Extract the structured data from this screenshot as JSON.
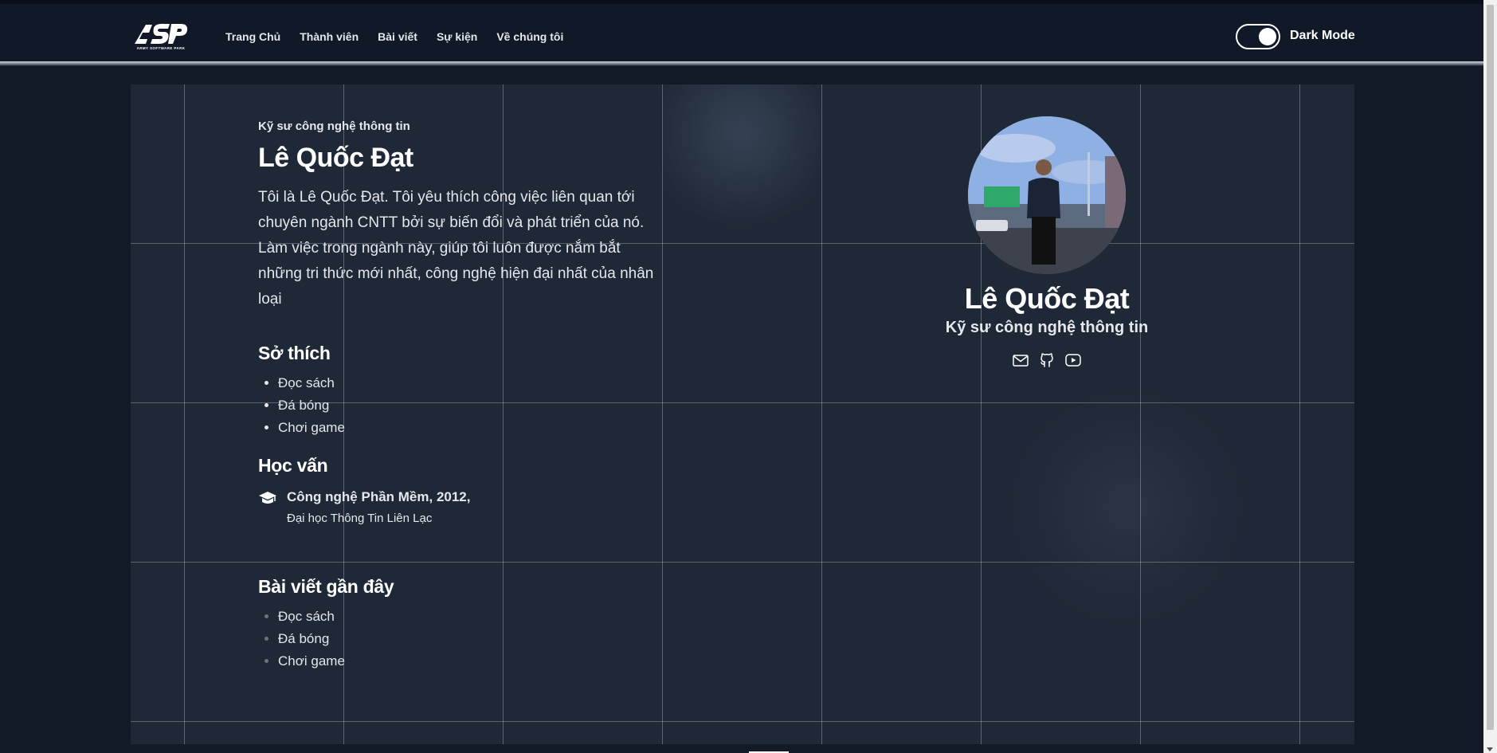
{
  "nav": {
    "logo_text": "ASP",
    "logo_subtext": "ARMY SOFTWARE PARK",
    "links": [
      "Trang Chủ",
      "Thành viên",
      "Bài viết",
      "Sự kiện",
      "Về chúng tôi"
    ],
    "dark_mode_label": "Dark Mode",
    "dark_mode_on": true
  },
  "profile": {
    "job_title": "Kỹ sư công nghệ thông tin",
    "name": "Lê Quốc Đạt",
    "intro": "Tôi là Lê Quốc Đạt. Tôi yêu thích công việc liên quan tới chuyên ngành CNTT bởi sự biến đổi và phát triển của nó. Làm việc trong ngành này, giúp tôi luôn được nắm bắt những tri thức mới nhất, công nghệ hiện đại nhất của nhân loại",
    "hobbies_title": "Sở thích",
    "hobbies": [
      "Đọc sách",
      "Đá bóng",
      "Chơi game"
    ],
    "education_title": "Học vấn",
    "education": {
      "degree": "Công nghệ Phần Mềm, 2012,",
      "school": "Đại học Thông Tin Liên Lạc"
    },
    "recent_posts_title": "Bài viết gần đây",
    "recent_posts": [
      "Đọc sách",
      "Đá bóng",
      "Chơi game"
    ]
  },
  "card": {
    "name": "Lê Quốc Đạt",
    "title": "Kỹ sư công nghệ thông tin",
    "socials": [
      "mail-icon",
      "github-icon",
      "youtube-icon"
    ]
  },
  "colors": {
    "background": "#121a28",
    "navbar": "#111827",
    "card": "#1f2836",
    "text": "#ffffff"
  }
}
